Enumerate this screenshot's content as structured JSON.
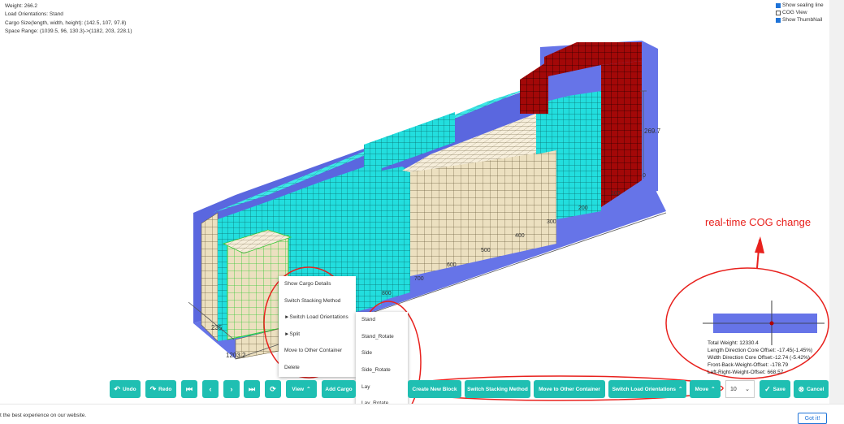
{
  "cargo_info": {
    "weight": "Weight: 266.2",
    "load_orientations": "Load Orientations: Stand",
    "cargo_size": "Cargo Size(length, width, height): (142.5, 107, 97.8)",
    "space_range": "Space Range: (1039.5, 96, 130.3)->(1182, 203, 228.1)"
  },
  "view_options": [
    {
      "label": "Show sealing line",
      "checked": true
    },
    {
      "label": "COG View",
      "checked": false
    },
    {
      "label": "Show ThumbNail",
      "checked": true
    }
  ],
  "dimension_labels": {
    "height": "269.7",
    "width": "235",
    "length": "1203.2",
    "zero": "0",
    "ruler": [
      "100",
      "200",
      "300",
      "400",
      "500",
      "600",
      "700",
      "800"
    ]
  },
  "annotation": "real-time COG change",
  "cog": {
    "total_weight": "Total Weight: 12330.4",
    "length_offset": "Length Direction Core Offset: -17.45(-1.45%)",
    "width_offset": "Width Direction Core Offset:-12.74 (-5.42%)",
    "front_back": "Front-Back-Weight-Offset: -178.79",
    "left_right": "Left-Right-Weight-Offset: 668.57"
  },
  "context_menu": {
    "items": [
      "Show Cargo Details",
      "Switch Stacking Method",
      "►Switch Load Orientations",
      "►Split",
      "Move to Other Container",
      "Delete"
    ]
  },
  "submenu": {
    "items": [
      "Stand",
      "Stand_Rotate",
      "Side",
      "Side_Rotate",
      "Lay",
      "Lay_Rotate"
    ]
  },
  "toolbar": {
    "undo": "Undo",
    "redo": "Redo",
    "view": "View",
    "add_cargo": "Add Cargo",
    "create_block": "Create New Block",
    "switch_stacking": "Switch Stacking Method",
    "move_container": "Move to Other Container",
    "switch_orient": "Switch Load Orientations",
    "move": "Move",
    "step_value": "10",
    "save": "Save",
    "cancel": "Cancel"
  },
  "cookie": {
    "text": "t the best experience on our website.",
    "button": "Got it!"
  },
  "colors": {
    "teal": "#1fbfb2",
    "container_blue": "#6674e8",
    "cyan_cargo": "#22dede",
    "beige_cargo": "#ece0c0",
    "red_cargo": "#a30808",
    "annotation_red": "#e8211d"
  }
}
